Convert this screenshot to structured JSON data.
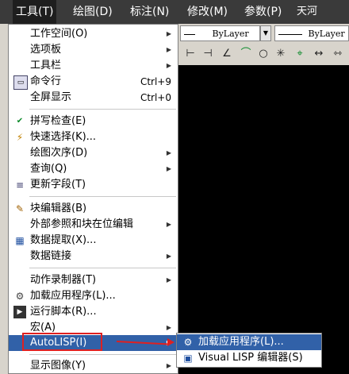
{
  "menubar": {
    "items": [
      {
        "label": "工具(T)",
        "active": true
      },
      {
        "label": "绘图(D)"
      },
      {
        "label": "标注(N)"
      },
      {
        "label": "修改(M)"
      },
      {
        "label": "参数(P)"
      },
      {
        "label": "天河PCCAD"
      }
    ]
  },
  "toolbar": {
    "layer1": "ByLayer",
    "layer2": "ByLayer"
  },
  "menu": {
    "items": [
      {
        "label": "工作空间(O)",
        "submenu": true
      },
      {
        "label": "选项板",
        "submenu": true
      },
      {
        "label": "工具栏",
        "submenu": true
      },
      {
        "label": "命令行",
        "shortcut": "Ctrl+9"
      },
      {
        "label": "全屏显示",
        "shortcut": "Ctrl+0"
      },
      {
        "label": "拼写检查(E)"
      },
      {
        "label": "快速选择(K)..."
      },
      {
        "label": "绘图次序(D)",
        "submenu": true
      },
      {
        "label": "查询(Q)",
        "submenu": true
      },
      {
        "label": "更新字段(T)"
      },
      {
        "label": "块编辑器(B)"
      },
      {
        "label": "外部参照和块在位编辑",
        "submenu": true
      },
      {
        "label": "数据提取(X)..."
      },
      {
        "label": "数据链接",
        "submenu": true
      },
      {
        "label": "动作录制器(T)",
        "submenu": true
      },
      {
        "label": "加载应用程序(L)..."
      },
      {
        "label": "运行脚本(R)..."
      },
      {
        "label": "宏(A)",
        "submenu": true
      },
      {
        "label": "AutoLISP(I)",
        "submenu": true,
        "highlighted": true
      },
      {
        "label": "显示图像(Y)",
        "submenu": true
      }
    ],
    "arrow_glyph": "▶"
  },
  "submenu": {
    "items": [
      {
        "label": "加载应用程序(L)...",
        "highlighted": true
      },
      {
        "label": "Visual LISP 编辑器(S)"
      }
    ]
  },
  "colors": {
    "highlight": "#3161a8",
    "annotation": "#e02020",
    "menubar": "#3a3a3a"
  }
}
